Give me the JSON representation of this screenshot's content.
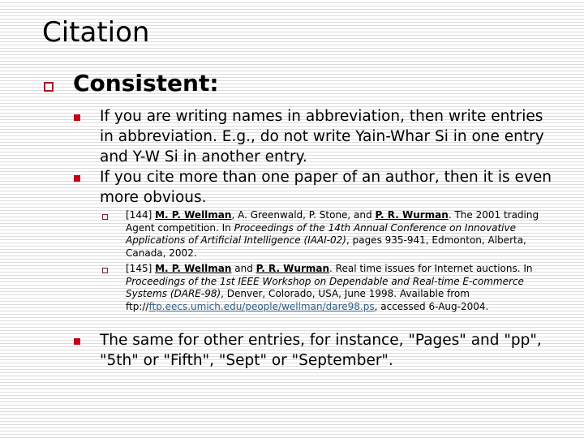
{
  "slide": {
    "title": "Citation",
    "heading": "Consistent:",
    "points": [
      {
        "text": "If you are writing names in abbreviation, then write entries in abbreviation. E.g., do not write Yain-Whar Si in one entry and Y-W Si in another entry."
      },
      {
        "text": "If you cite more than one paper of an author, then it is even more obvious."
      },
      {
        "text": "The same for other entries, for instance, \"Pages\" and \"pp\",  \"5th\" or \"Fifth\", \"Sept\" or \"September\"."
      }
    ],
    "references": [
      {
        "id": "[144]",
        "author1": "M. P. Wellman",
        "sep1": ", A. Greenwald, P. Stone, and ",
        "author2": "P. R. Wurman",
        "after_authors": ". The 2001 trading Agent competition. In ",
        "venue": "Proceedings of the 14th Annual Conference on Innovative Applications of Artificial Intelligence (IAAI-02)",
        "tail": ", pages 935-941, Edmonton, Alberta, Canada, 2002."
      },
      {
        "id": "[145]",
        "author1": "M. P. Wellman",
        "sep1": " and ",
        "author2": "P. R. Wurman",
        "after_authors": ". Real time issues for Internet auctions. In ",
        "venue": "Proceedings of the 1st IEEE Workshop on Dependable and Real-time E-commerce Systems (DARE-98)",
        "tail": ", Denver, Colorado, USA, June 1998. Available from ftp://",
        "link": "ftp.eecs.umich.edu/people/wellman/dare98.ps",
        "tail2": ", accessed 6-Aug-2004."
      }
    ]
  },
  "colors": {
    "bullet_primary": "#a31a2a",
    "bullet_secondary": "#c00018",
    "link": "#2f5f86"
  }
}
